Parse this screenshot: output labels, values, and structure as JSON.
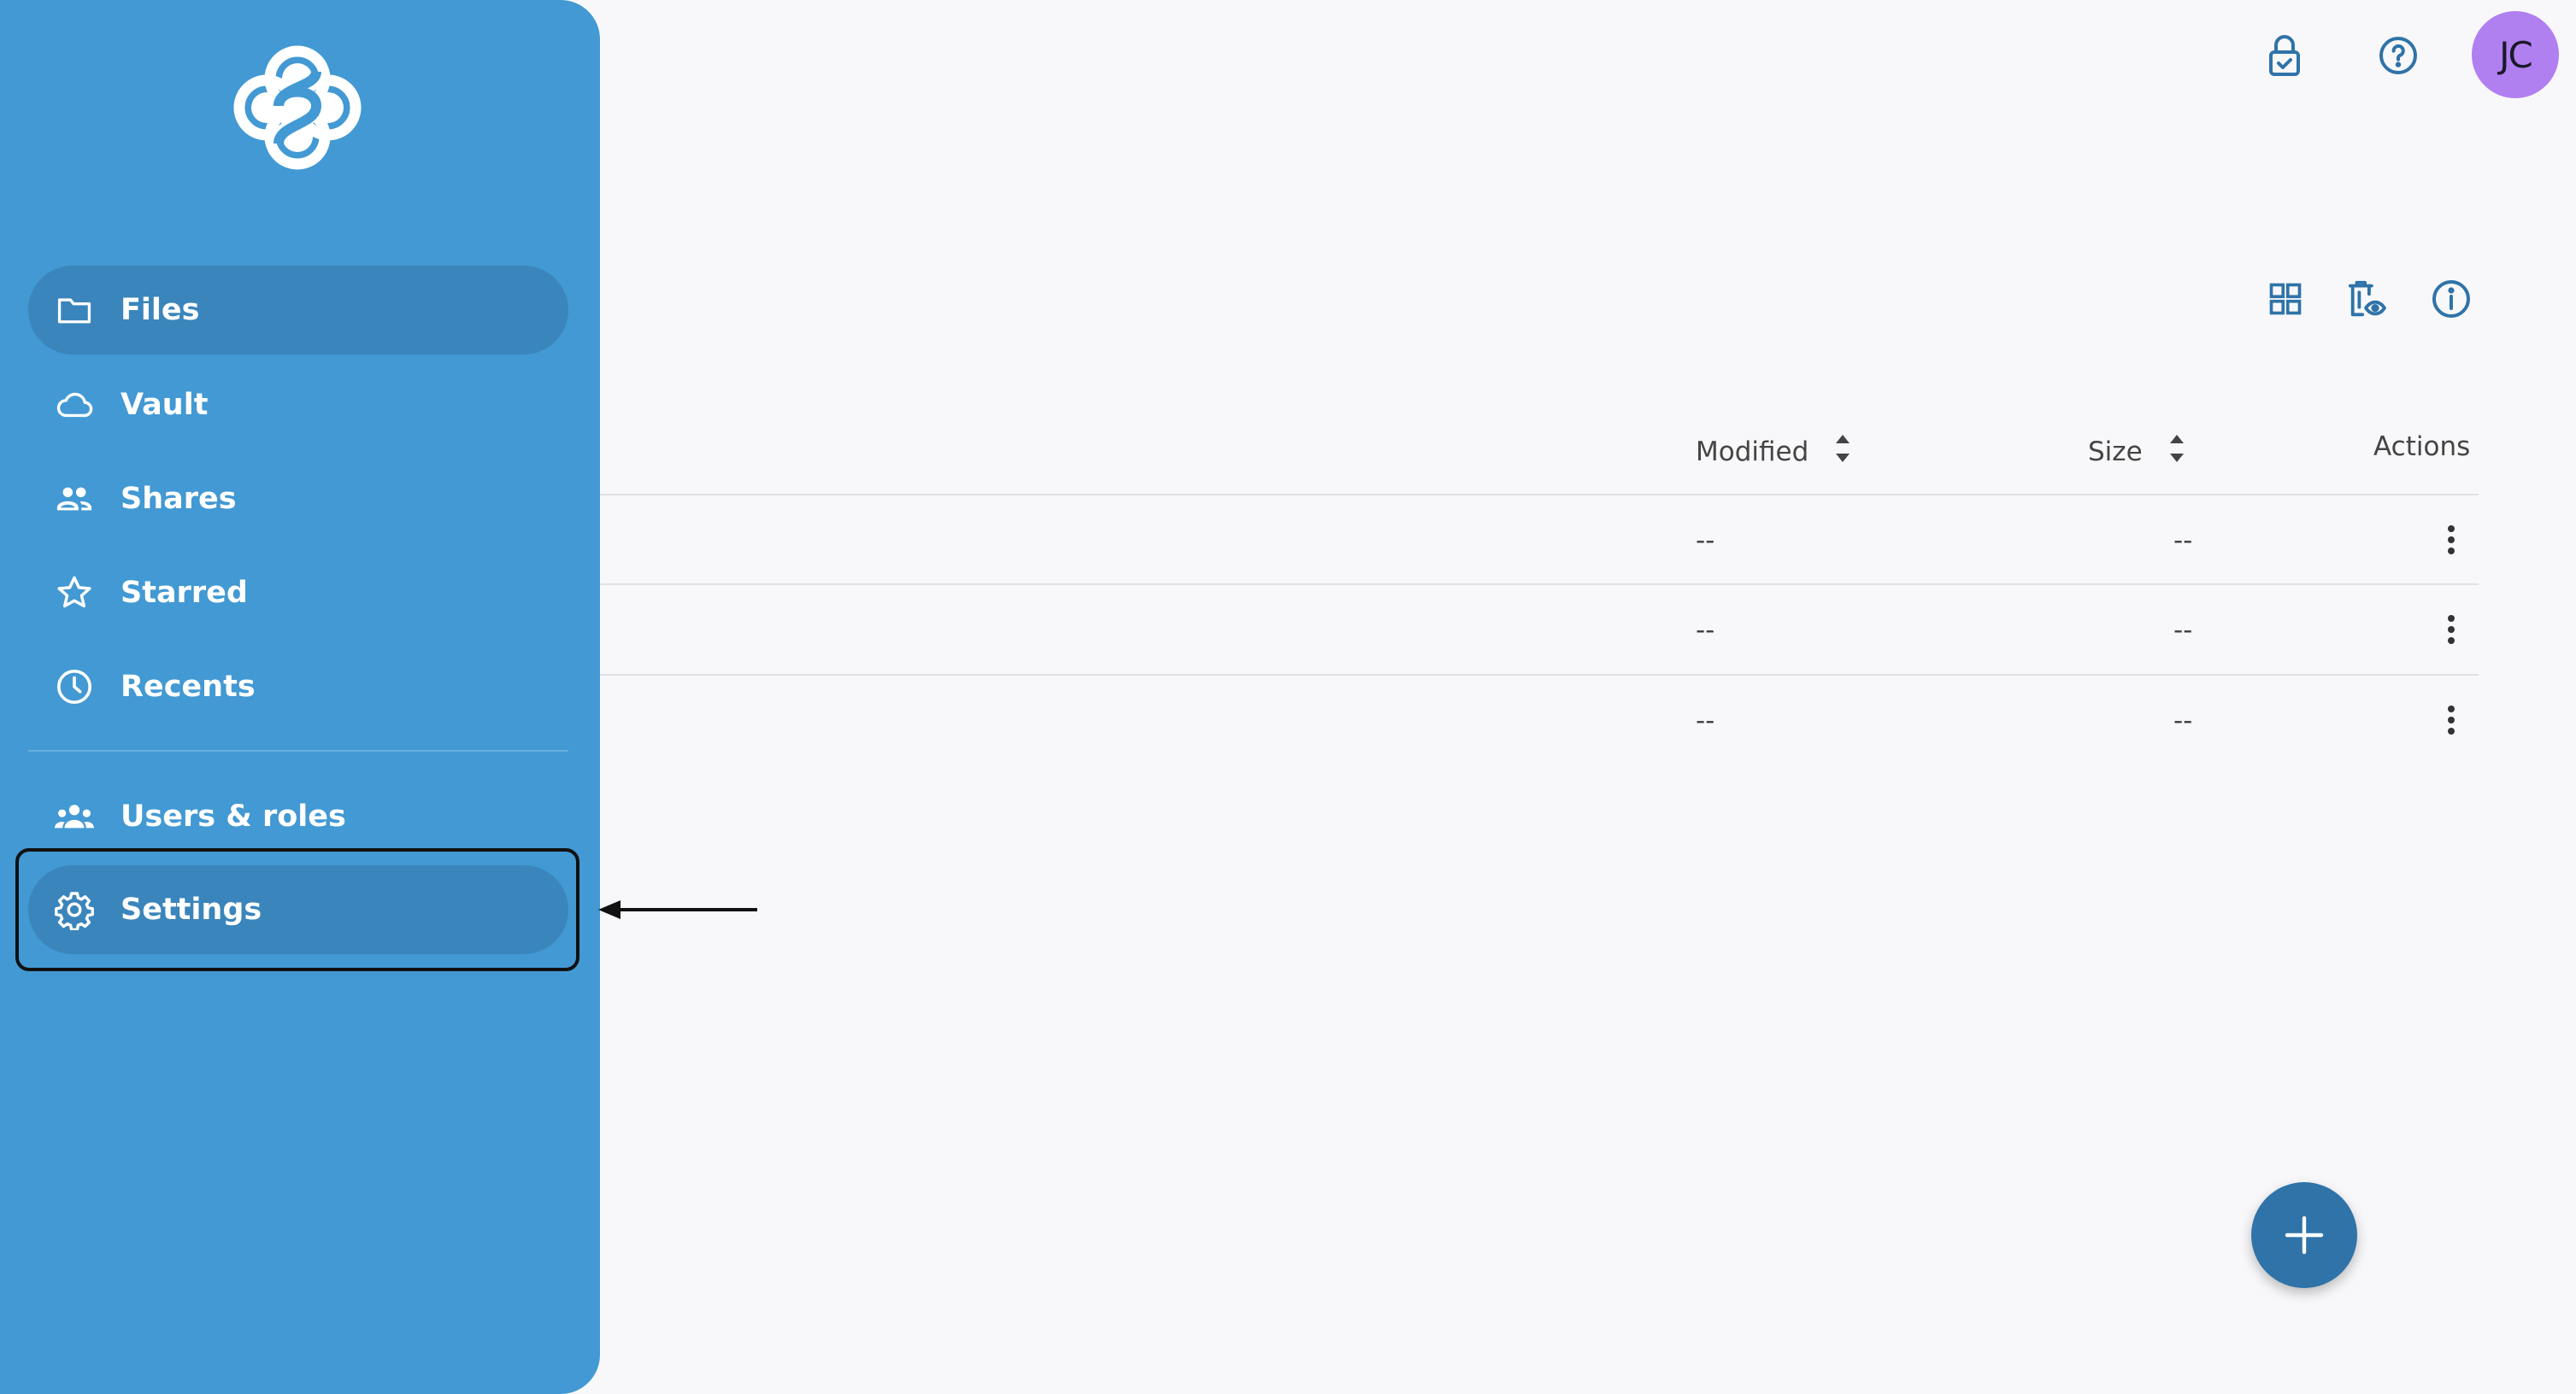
{
  "sidebar": {
    "logo": "sync-logo",
    "items": [
      {
        "label": "Files",
        "icon": "folder-icon",
        "active": true
      },
      {
        "label": "Vault",
        "icon": "cloud-icon",
        "active": false
      },
      {
        "label": "Shares",
        "icon": "people-icon",
        "active": false
      },
      {
        "label": "Starred",
        "icon": "star-icon",
        "active": false
      },
      {
        "label": "Recents",
        "icon": "clock-icon",
        "active": false
      }
    ],
    "admin_items": [
      {
        "label": "Users & roles",
        "icon": "users-icon",
        "active": false
      },
      {
        "label": "Settings",
        "icon": "gear-icon",
        "active": true
      }
    ]
  },
  "header": {
    "icons": [
      "lock-check-icon",
      "help-icon"
    ],
    "avatar_initials": "JC"
  },
  "toolbar": {
    "icons": [
      "grid-view-icon",
      "trash-eye-icon",
      "info-icon"
    ]
  },
  "table": {
    "columns": {
      "modified": "Modified",
      "size": "Size",
      "actions": "Actions"
    },
    "rows": [
      {
        "modified": "--",
        "size": "--"
      },
      {
        "modified": "--",
        "size": "--"
      },
      {
        "modified": "--",
        "size": "--"
      }
    ]
  },
  "fab": {
    "icon": "plus-icon"
  },
  "colors": {
    "sidebar": "#4299d3",
    "sidebar_active": "#3a85bb",
    "accent": "#2f73a8",
    "avatar": "#b07ff0",
    "background": "#f8f8fa"
  }
}
